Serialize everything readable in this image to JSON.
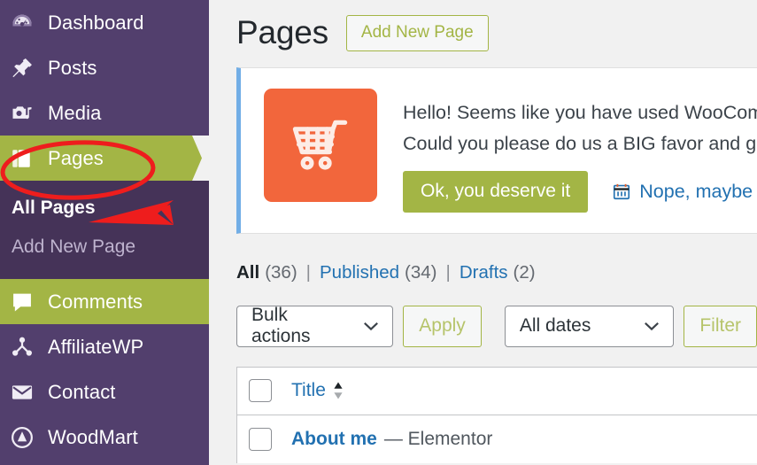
{
  "sidebar": {
    "items": [
      {
        "label": "Dashboard",
        "icon": "dashboard-gauge-icon",
        "state": "normal"
      },
      {
        "label": "Posts",
        "icon": "pushpin-icon",
        "state": "normal"
      },
      {
        "label": "Media",
        "icon": "media-camera-music-icon",
        "state": "normal"
      },
      {
        "label": "Pages",
        "icon": "pages-document-icon",
        "state": "current"
      },
      {
        "label": "Comments",
        "icon": "comment-bubble-icon",
        "state": "current"
      },
      {
        "label": "AffiliateWP",
        "icon": "affiliate-network-icon",
        "state": "normal"
      },
      {
        "label": "Contact",
        "icon": "envelope-icon",
        "state": "normal"
      },
      {
        "label": "WoodMart",
        "icon": "woodmart-circle-arrow-icon",
        "state": "normal"
      }
    ],
    "submenu": [
      {
        "label": "All Pages",
        "state": "current"
      },
      {
        "label": "Add New Page",
        "state": "plain"
      }
    ],
    "colors": {
      "background": "#523f6d",
      "submenu_background": "#453358",
      "current_highlight": "#a3b545",
      "text": "#ffffff",
      "submenu_text": "#bfb4cf"
    }
  },
  "header": {
    "title": "Pages",
    "add_new_label": "Add New Page"
  },
  "notice": {
    "icon": "woocommerce-cart-icon",
    "icon_color": "#f2663c",
    "accent_border": "#72aee6",
    "line1": "Hello! Seems like you have used WooCommerce",
    "line2": "Could you please do us a BIG favor and give it a",
    "accept_label": "Ok, you deserve it",
    "accept_color": "#a3b545",
    "later_label": "Nope, maybe later",
    "later_icon": "calendar-icon",
    "later_color": "#2271b1"
  },
  "filters": {
    "links": [
      {
        "label": "All",
        "count": "(36)",
        "active": true
      },
      {
        "label": "Published",
        "count": "(34)",
        "active": false
      },
      {
        "label": "Drafts",
        "count": "(2)",
        "active": false
      }
    ],
    "separator": "|"
  },
  "toolbar": {
    "bulk_actions_value": "Bulk actions",
    "apply_label": "Apply",
    "all_dates_value": "All dates",
    "filter_label": "Filter"
  },
  "table": {
    "columns": [
      {
        "label": "Title",
        "sortable": true
      }
    ],
    "rows": [
      {
        "title": "About me",
        "suffix": "— Elementor"
      }
    ]
  },
  "annotations": {
    "ellipse_color": "#ee1d1d",
    "arrow_color": "#ee1d1d",
    "ellipse_target": "Pages",
    "arrow_target": "All Pages"
  }
}
